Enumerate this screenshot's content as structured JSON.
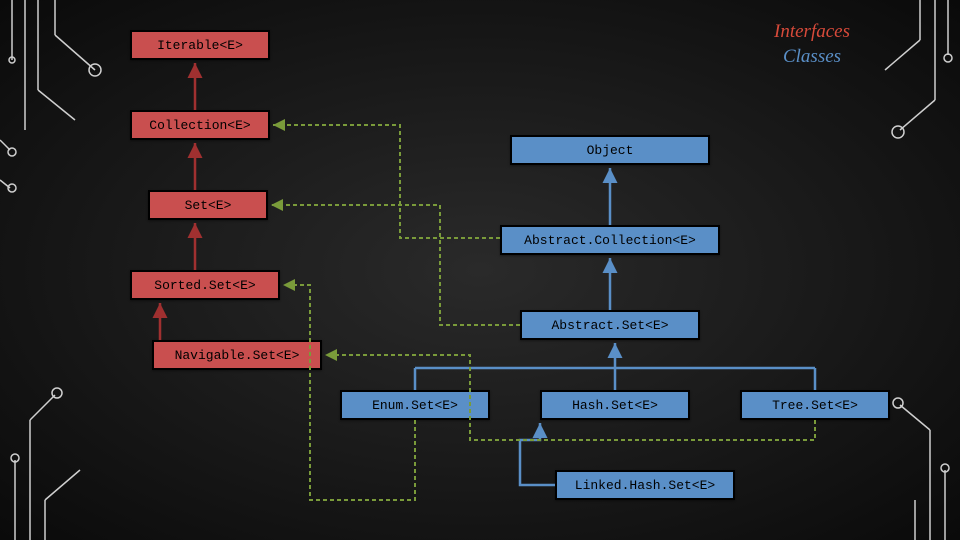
{
  "legend": {
    "interfaces": "Interfaces",
    "classes": "Classes"
  },
  "nodes": {
    "iterable": {
      "label": "Iterable<E>"
    },
    "collection": {
      "label": "Collection<E>"
    },
    "set": {
      "label": "Set<E>"
    },
    "sortedset": {
      "label": "Sorted.Set<E>"
    },
    "navset": {
      "label": "Navigable.Set<E>"
    },
    "object": {
      "label": "Object"
    },
    "abscoll": {
      "label": "Abstract.Collection<E>"
    },
    "absset": {
      "label": "Abstract.Set<E>"
    },
    "enumset": {
      "label": "Enum.Set<E>"
    },
    "hashset": {
      "label": "Hash.Set<E>"
    },
    "treeset": {
      "label": "Tree.Set<E>"
    },
    "linkedhs": {
      "label": "Linked.Hash.Set<E>"
    }
  }
}
